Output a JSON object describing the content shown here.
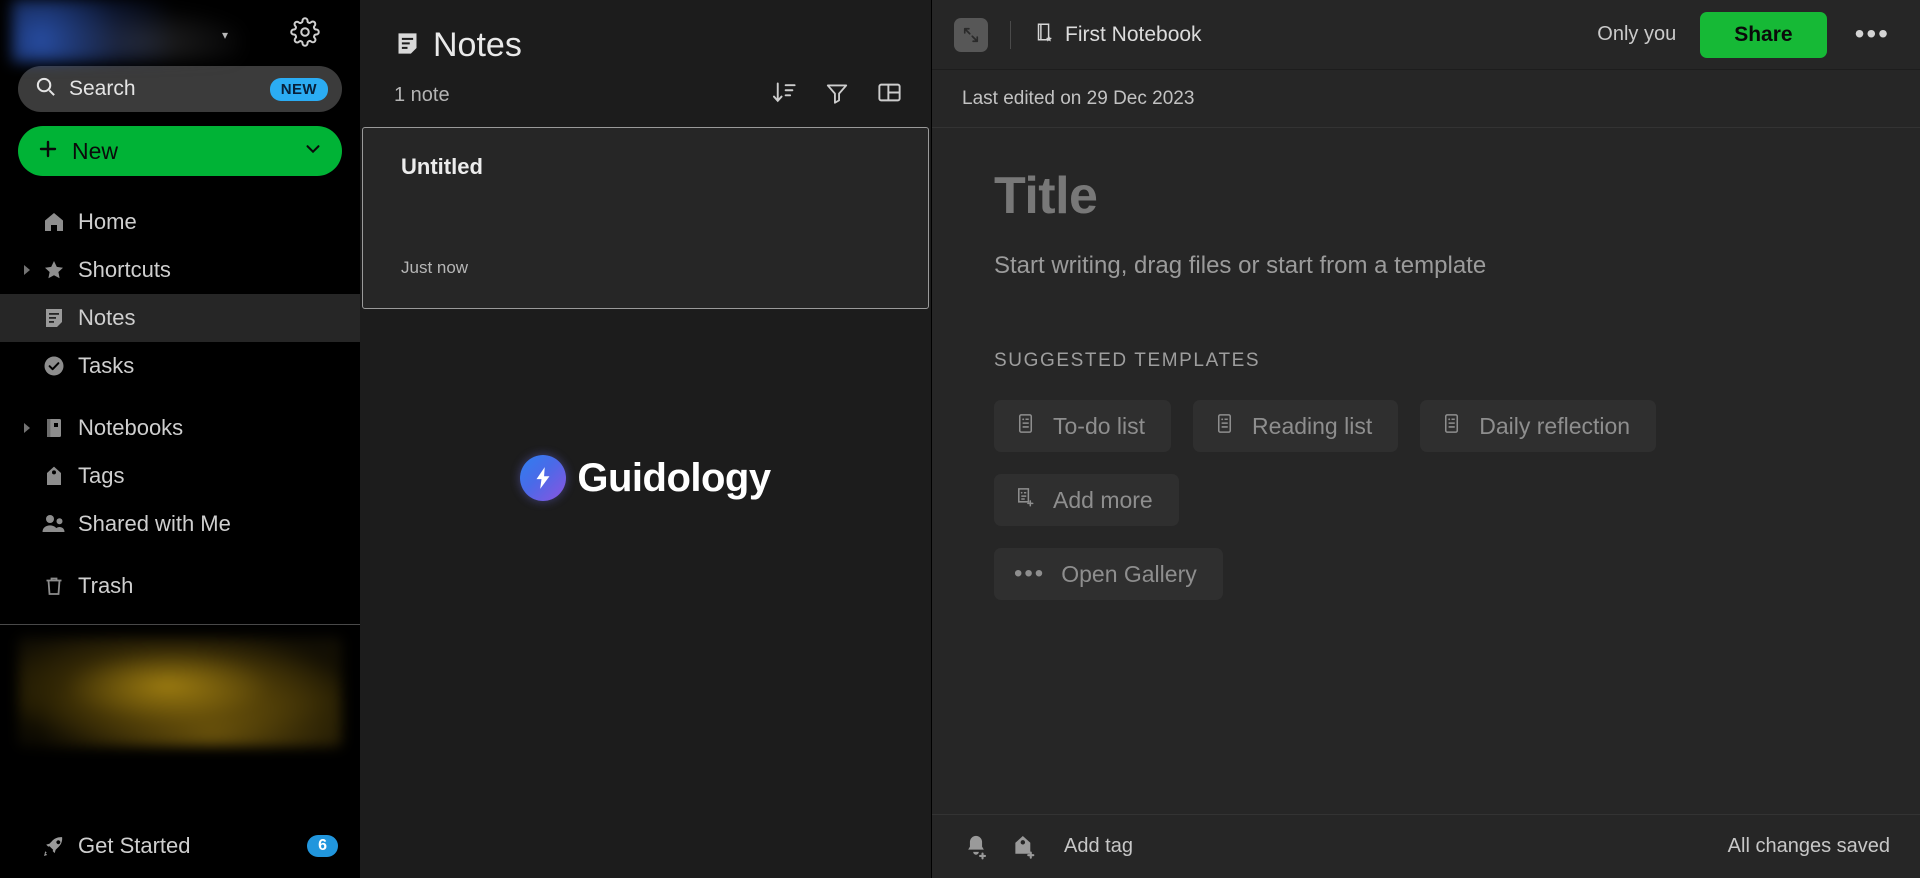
{
  "sidebar": {
    "search": {
      "placeholder": "Search",
      "badge": "NEW",
      "icon": "search-icon"
    },
    "new_button": {
      "label": "New",
      "icon": "plus-icon",
      "chevron": "chevron-down-icon"
    },
    "nav_items": [
      {
        "label": "Home",
        "icon": "home-icon",
        "active": false,
        "expandable": false
      },
      {
        "label": "Shortcuts",
        "icon": "star-icon",
        "active": false,
        "expandable": true
      },
      {
        "label": "Notes",
        "icon": "note-icon",
        "active": true,
        "expandable": false
      },
      {
        "label": "Tasks",
        "icon": "check-circle-icon",
        "active": false,
        "expandable": false
      },
      {
        "label": "Notebooks",
        "icon": "notebook-icon",
        "active": false,
        "expandable": true
      },
      {
        "label": "Tags",
        "icon": "tag-icon",
        "active": false,
        "expandable": false
      },
      {
        "label": "Shared with Me",
        "icon": "people-icon",
        "active": false,
        "expandable": false
      },
      {
        "label": "Trash",
        "icon": "trash-icon",
        "active": false,
        "expandable": false
      }
    ],
    "get_started": {
      "label": "Get Started",
      "badge": "6",
      "icon": "rocket-icon"
    },
    "settings_icon": "gear-icon"
  },
  "note_list": {
    "title": "Notes",
    "title_icon": "note-icon",
    "count": "1 note",
    "tools": [
      {
        "name": "sort-icon"
      },
      {
        "name": "filter-icon"
      },
      {
        "name": "view-layout-icon"
      }
    ],
    "notes": [
      {
        "title": "Untitled",
        "time": "Just now",
        "selected": true
      }
    ],
    "watermark": "Guidology"
  },
  "editor": {
    "expand_icon": "expand-icon",
    "notebook": {
      "name": "First Notebook",
      "icon": "notebook-star-icon"
    },
    "visibility": "Only you",
    "share_label": "Share",
    "more_icon": "ellipsis-icon",
    "last_edited": "Last edited on 29 Dec 2023",
    "title_placeholder": "Title",
    "body_placeholder": "Start writing, drag files or start from a template",
    "templates_heading": "SUGGESTED TEMPLATES",
    "template_rows": [
      [
        {
          "label": "To-do list",
          "icon": "template-doc-icon"
        },
        {
          "label": "Reading list",
          "icon": "template-doc-icon"
        },
        {
          "label": "Daily reflection",
          "icon": "template-doc-icon"
        }
      ],
      [
        {
          "label": "Add more",
          "icon": "doc-plus-icon"
        }
      ],
      [
        {
          "label": "Open Gallery",
          "icon": "ellipsis-icon"
        }
      ]
    ],
    "footer": {
      "reminder_icon": "bell-plus-icon",
      "tag_icon": "tag-plus-icon",
      "add_tag_label": "Add tag",
      "save_status": "All changes saved"
    }
  },
  "colors": {
    "accent_green": "#00b336",
    "share_green": "#16b936",
    "badge_blue": "#2bacf3",
    "sidebar_bg": "#000000",
    "list_bg": "#1c1c1c",
    "editor_bg": "#262626"
  }
}
